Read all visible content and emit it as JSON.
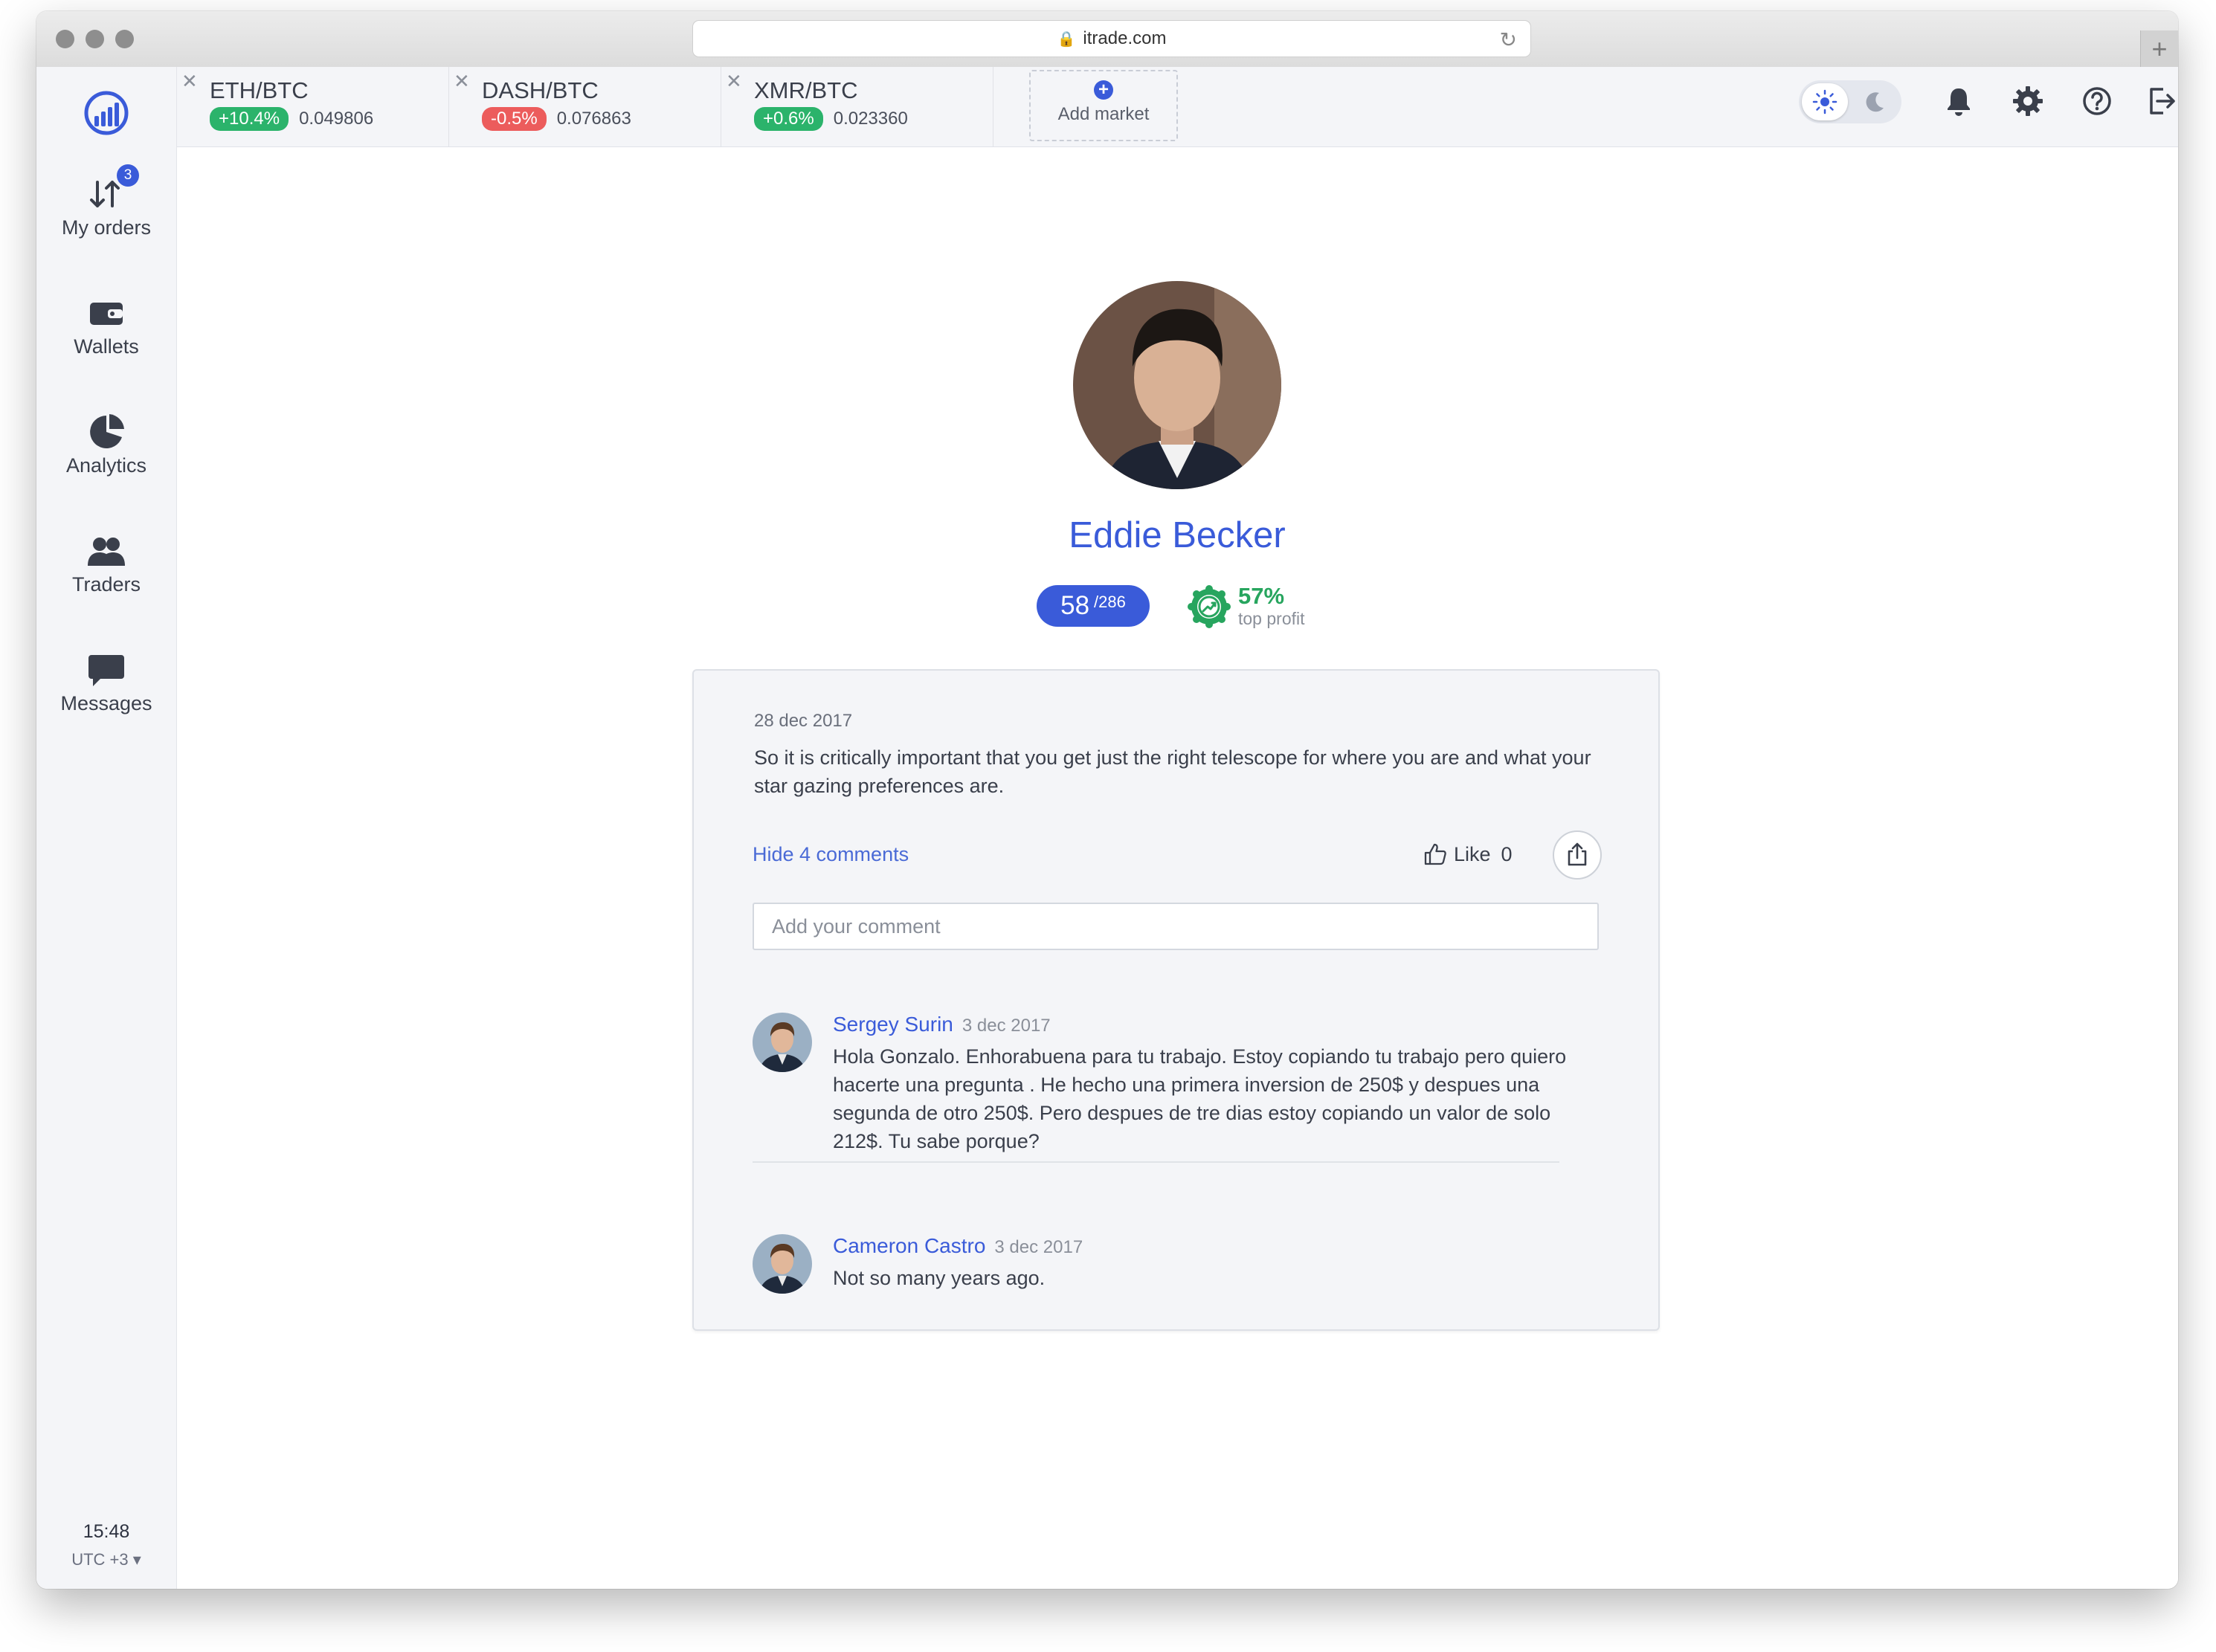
{
  "browser": {
    "url": "itrade.com"
  },
  "sidebar": {
    "items": [
      {
        "label": "My orders",
        "icon": "arrows-up-down-icon",
        "badge": "3"
      },
      {
        "label": "Wallets",
        "icon": "wallet-icon"
      },
      {
        "label": "Analytics",
        "icon": "pie-chart-icon"
      },
      {
        "label": "Traders",
        "icon": "users-icon"
      },
      {
        "label": "Messages",
        "icon": "chat-bubble-icon"
      }
    ],
    "clock": {
      "time": "15:48",
      "timezone": "UTC +3 ▾"
    }
  },
  "markets": [
    {
      "pair": "ETH/BTC",
      "change": "+10.4%",
      "direction": "up",
      "price": "0.049806"
    },
    {
      "pair": "DASH/BTC",
      "change": "-0.5%",
      "direction": "down",
      "price": "0.076863"
    },
    {
      "pair": "XMR/BTC",
      "change": "+0.6%",
      "direction": "up",
      "price": "0.023360"
    }
  ],
  "add_market": {
    "label": "Add market"
  },
  "toolbar": {
    "theme": "light",
    "icons": [
      "sun-icon",
      "moon-icon",
      "bell-icon",
      "gear-icon",
      "help-icon",
      "logout-icon"
    ]
  },
  "profile": {
    "name": "Eddie Becker",
    "rank": "58",
    "rank_total": "/286",
    "profit_pct": "57%",
    "profit_label": "top profit"
  },
  "post": {
    "date": "28 dec 2017",
    "text": "So it is critically important that you get just the right telescope for where you are and what your star gazing preferences are.",
    "hide_comments": "Hide 4 comments",
    "like_label": "Like",
    "like_count": "0",
    "comment_placeholder": "Add your comment",
    "comments": [
      {
        "author": "Sergey Surin",
        "date": "3 dec 2017",
        "text": " Hola Gonzalo. Enhorabuena para tu trabajo. Estoy copiando tu trabajo pero quiero hacerte una pregunta . He hecho una primera inversion de 250$ y despues una segunda de otro 250$. Pero despues de tre dias estoy copiando un valor de solo 212$. Tu sabe porque?"
      },
      {
        "author": "Cameron Castro",
        "date": "3 dec 2017",
        "text": "Not so many years ago."
      }
    ]
  },
  "colors": {
    "accent": "#3a5bd9",
    "positive": "#2bb36b",
    "negative": "#ec5c5c",
    "sidebar_bg": "#f4f5f8"
  }
}
